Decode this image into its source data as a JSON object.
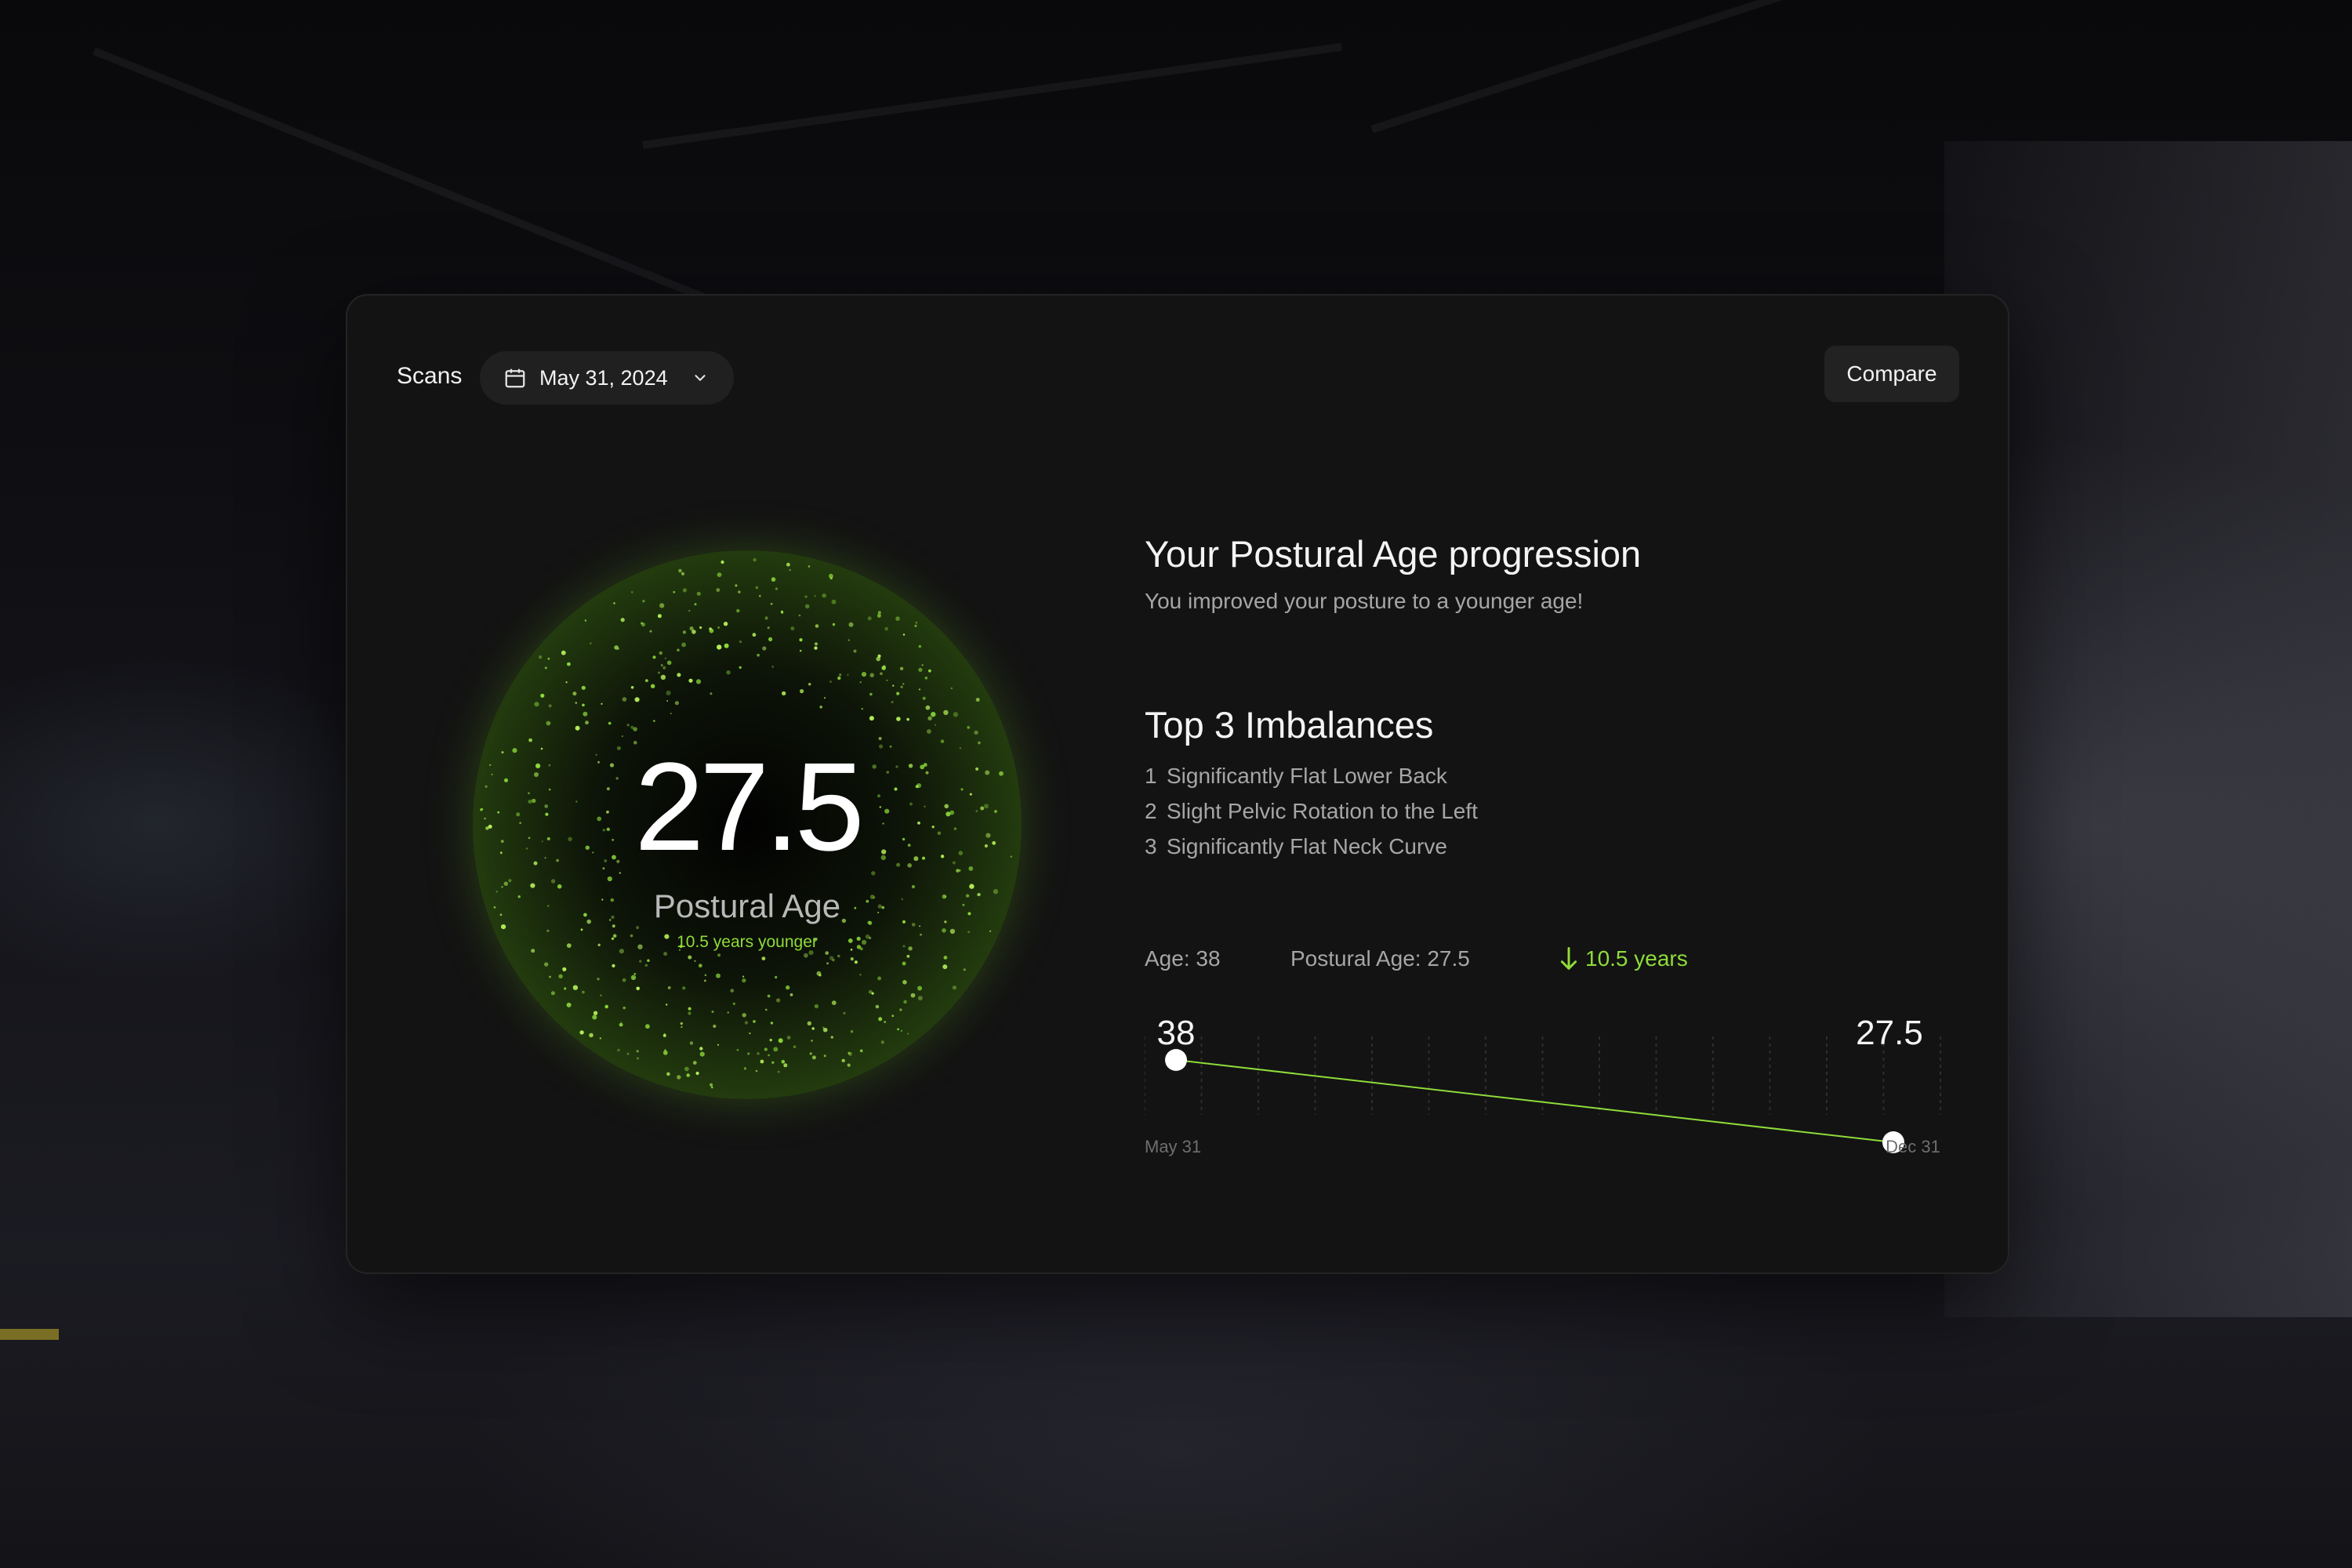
{
  "header": {
    "scans_label": "Scans",
    "date_value": "May 31, 2024",
    "compare_label": "Compare"
  },
  "orb": {
    "value": "27.5",
    "label": "Postural Age",
    "sub": "10.5 years younger"
  },
  "progression": {
    "title": "Your Postural Age progression",
    "subtitle": "You improved your posture to a younger age!"
  },
  "imbalances": {
    "title": "Top 3 Imbalances",
    "items": [
      {
        "num": "1",
        "text": "Significantly Flat Lower Back"
      },
      {
        "num": "2",
        "text": "Slight Pelvic Rotation to the Left"
      },
      {
        "num": "3",
        "text": "Significantly Flat Neck Curve"
      }
    ]
  },
  "stats": {
    "age": "Age: 38",
    "postural_age": "Postural Age: 27.5",
    "delta": "10.5 years"
  },
  "chart_data": {
    "type": "line",
    "x": [
      "May 31",
      "Dec 31"
    ],
    "y": [
      38,
      27.5
    ],
    "point_labels": [
      "38",
      "27.5"
    ],
    "x_labels": [
      "May 31",
      "Dec 31"
    ],
    "grid_columns": 14
  },
  "colors": {
    "accent": "#8fdc3a",
    "card": "#131313",
    "text": "#f4f4f4",
    "muted": "#a6a6a6"
  },
  "icons": {
    "date": "calendar-icon",
    "dropdown": "chevron-down-icon",
    "delta": "arrow-down-icon"
  }
}
